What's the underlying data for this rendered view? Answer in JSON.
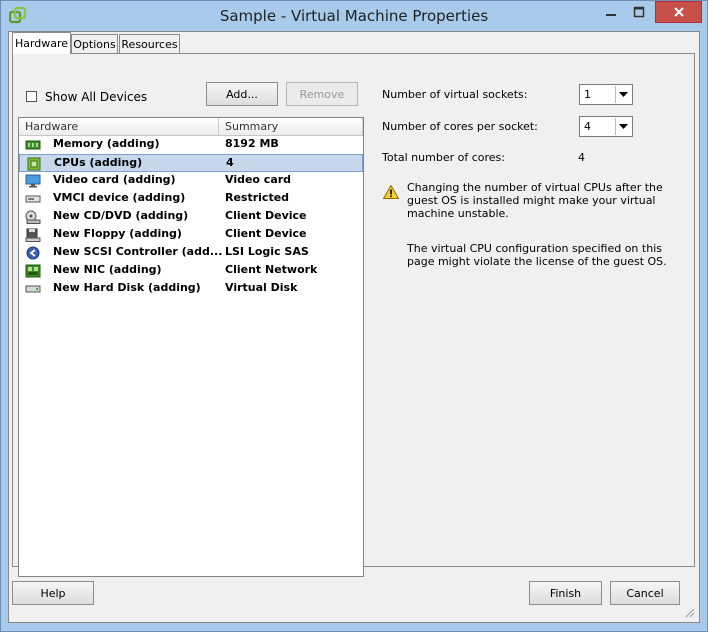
{
  "window": {
    "title": "Sample - Virtual Machine Properties",
    "titlebar_color": "#a9cbeb",
    "close_button_color": "#c7504a"
  },
  "tabs": [
    {
      "label": "Hardware",
      "active": true
    },
    {
      "label": "Options",
      "active": false
    },
    {
      "label": "Resources",
      "active": false
    }
  ],
  "hardware": {
    "show_all_devices_label": "Show All Devices",
    "show_all_devices_checked": false,
    "add_label": "Add...",
    "remove_label": "Remove",
    "columns": [
      "Hardware",
      "Summary"
    ],
    "rows": [
      {
        "icon": "memory-icon",
        "name": "Memory (adding)",
        "summary": "8192 MB",
        "selected": false
      },
      {
        "icon": "cpu-icon",
        "name": "CPUs (adding)",
        "summary": "4",
        "selected": true
      },
      {
        "icon": "monitor-icon",
        "name": "Video card  (adding)",
        "summary": "Video card",
        "selected": false
      },
      {
        "icon": "vmci-device-icon",
        "name": "VMCI device (adding)",
        "summary": "Restricted",
        "selected": false
      },
      {
        "icon": "cd-dvd-drive-icon",
        "name": "New CD/DVD (adding)",
        "summary": "Client Device",
        "selected": false
      },
      {
        "icon": "floppy-drive-icon",
        "name": "New Floppy (adding)",
        "summary": "Client Device",
        "selected": false
      },
      {
        "icon": "scsi-controller-icon",
        "name": "New SCSI Controller (add...",
        "summary": "LSI Logic SAS",
        "selected": false
      },
      {
        "icon": "network-card-icon",
        "name": "New NIC (adding)",
        "summary": "Client Network",
        "selected": false
      },
      {
        "icon": "hard-disk-icon",
        "name": "New Hard Disk (adding)",
        "summary": "Virtual Disk",
        "selected": false
      }
    ]
  },
  "cpu_settings": {
    "sockets_label": "Number of virtual sockets:",
    "sockets_value": "1",
    "cores_label": "Number of cores per socket:",
    "cores_value": "4",
    "total_label": "Total number of cores:",
    "total_value": "4",
    "warning_text": "Changing the number of virtual CPUs after the guest OS is installed might make your virtual machine unstable.",
    "license_text": "The virtual CPU configuration specified on this page might violate the license of the guest OS."
  },
  "footer": {
    "help_label": "Help",
    "finish_label": "Finish",
    "cancel_label": "Cancel"
  }
}
